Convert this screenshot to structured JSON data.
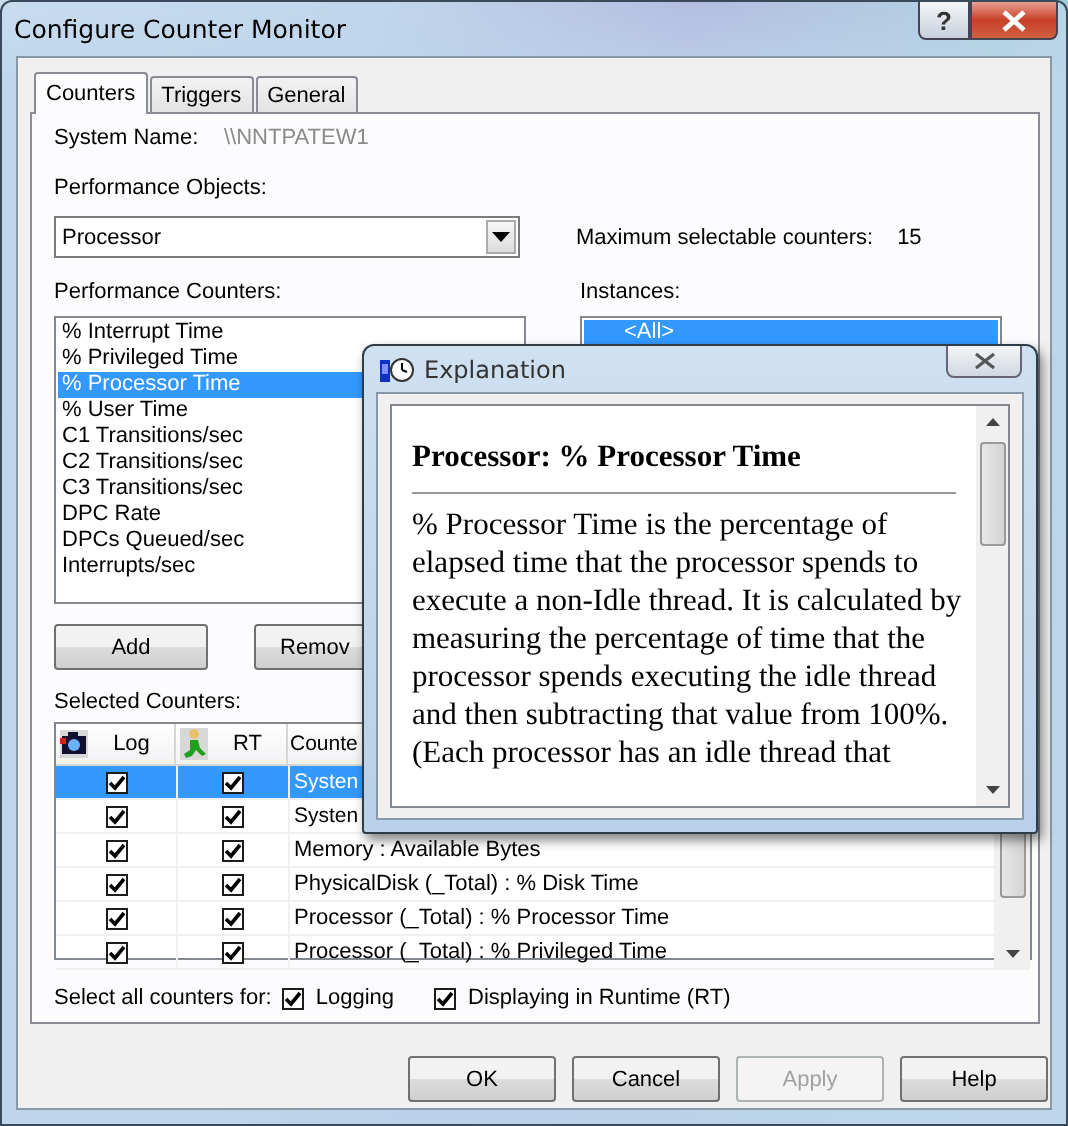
{
  "window": {
    "title": "Configure Counter Monitor",
    "help_glyph": "?"
  },
  "tabs": [
    {
      "label": "Counters",
      "selected": true
    },
    {
      "label": "Triggers",
      "selected": false
    },
    {
      "label": "General",
      "selected": false
    }
  ],
  "system_name": {
    "label": "System Name:",
    "value": "\\\\NNTPATEW1"
  },
  "performance_objects": {
    "label": "Performance Objects:",
    "value": "Processor"
  },
  "max_counters": {
    "label": "Maximum selectable counters:",
    "value": "15"
  },
  "performance_counters": {
    "label": "Performance Counters:",
    "items": [
      {
        "label": "% Interrupt Time",
        "selected": false
      },
      {
        "label": "% Privileged Time",
        "selected": false
      },
      {
        "label": "% Processor Time",
        "selected": true
      },
      {
        "label": "% User Time",
        "selected": false
      },
      {
        "label": "C1 Transitions/sec",
        "selected": false
      },
      {
        "label": "C2 Transitions/sec",
        "selected": false
      },
      {
        "label": "C3 Transitions/sec",
        "selected": false
      },
      {
        "label": "DPC Rate",
        "selected": false
      },
      {
        "label": "DPCs Queued/sec",
        "selected": false
      },
      {
        "label": "Interrupts/sec",
        "selected": false
      }
    ]
  },
  "instances": {
    "label": "Instances:",
    "items": [
      {
        "label": "<All>",
        "selected": true
      }
    ]
  },
  "list_buttons": [
    "Add",
    "Remov"
  ],
  "selected_counters": {
    "label": "Selected Counters:",
    "columns": [
      "Log",
      "RT",
      "Counte"
    ],
    "rows": [
      {
        "log": true,
        "rt": true,
        "counter": "Systen",
        "selected": true
      },
      {
        "log": true,
        "rt": true,
        "counter": "Systen",
        "selected": false
      },
      {
        "log": true,
        "rt": true,
        "counter": "Memory : Available Bytes",
        "selected": false
      },
      {
        "log": true,
        "rt": true,
        "counter": "PhysicalDisk (_Total) : % Disk Time",
        "selected": false
      },
      {
        "log": true,
        "rt": true,
        "counter": "Processor (_Total) : % Processor Time",
        "selected": false
      },
      {
        "log": true,
        "rt": true,
        "counter": "Processor (_Total) : % Privileged Time",
        "selected": false
      }
    ]
  },
  "select_all": {
    "label": "Select all counters for:",
    "options": [
      {
        "label": "Logging",
        "checked": true
      },
      {
        "label": "Displaying in Runtime (RT)",
        "checked": true
      }
    ]
  },
  "dialog_buttons": [
    {
      "label": "OK",
      "disabled": false
    },
    {
      "label": "Cancel",
      "disabled": false
    },
    {
      "label": "Apply",
      "disabled": true
    },
    {
      "label": "Help",
      "disabled": false
    }
  ],
  "explanation": {
    "title": "Explanation",
    "heading": "Processor: % Processor Time",
    "body": "% Processor Time is the percentage of elapsed time that the processor spends to execute a non-Idle thread. It is calculated by measuring the percentage of time that the processor spends executing the idle thread and then subtracting that value from 100%. (Each processor has an idle thread that"
  }
}
